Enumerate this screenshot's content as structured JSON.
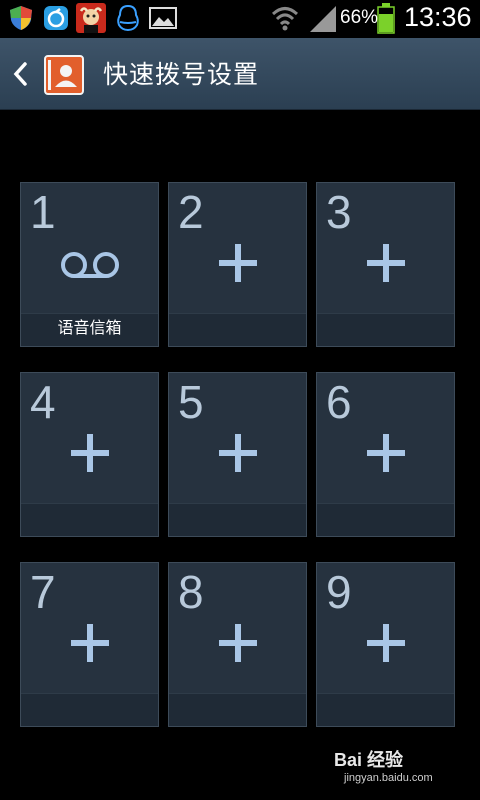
{
  "status_bar": {
    "icons": [
      "shield-icon",
      "app-icon",
      "cow-avatar-icon",
      "qq-penguin-icon",
      "gallery-icon"
    ],
    "right_icons": [
      "wifi-icon",
      "signal-icon",
      "battery-icon"
    ],
    "battery": "66%",
    "time": "13:36"
  },
  "action_bar": {
    "title": "快速拨号设置"
  },
  "tiles": [
    {
      "num": "1",
      "label": "语音信箱",
      "icon": "voicemail-icon"
    },
    {
      "num": "2",
      "label": "",
      "icon": "add-icon"
    },
    {
      "num": "3",
      "label": "",
      "icon": "add-icon"
    },
    {
      "num": "4",
      "label": "",
      "icon": "add-icon"
    },
    {
      "num": "5",
      "label": "",
      "icon": "add-icon"
    },
    {
      "num": "6",
      "label": "",
      "icon": "add-icon"
    },
    {
      "num": "7",
      "label": "",
      "icon": "add-icon"
    },
    {
      "num": "8",
      "label": "",
      "icon": "add-icon"
    },
    {
      "num": "9",
      "label": "",
      "icon": "add-icon"
    }
  ],
  "watermark": {
    "main": "Bai 经验",
    "sub": "jingyan.baidu.com"
  },
  "colors": {
    "action_bar": "#34495e",
    "tile": "#26323f",
    "tile_number": "#b8c9da",
    "plus": "#a9c6e6"
  }
}
